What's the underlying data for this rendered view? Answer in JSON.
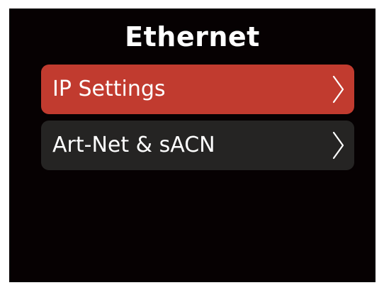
{
  "screen": {
    "title": "Ethernet",
    "background_color": "#060102"
  },
  "menu": {
    "items": [
      {
        "label": "IP Settings",
        "selected": true,
        "bg_color": "#c13b2f",
        "icon": "chevron-right-icon"
      },
      {
        "label": "Art-Net & sACN",
        "selected": false,
        "bg_color": "#252423",
        "icon": "chevron-right-icon"
      }
    ]
  }
}
